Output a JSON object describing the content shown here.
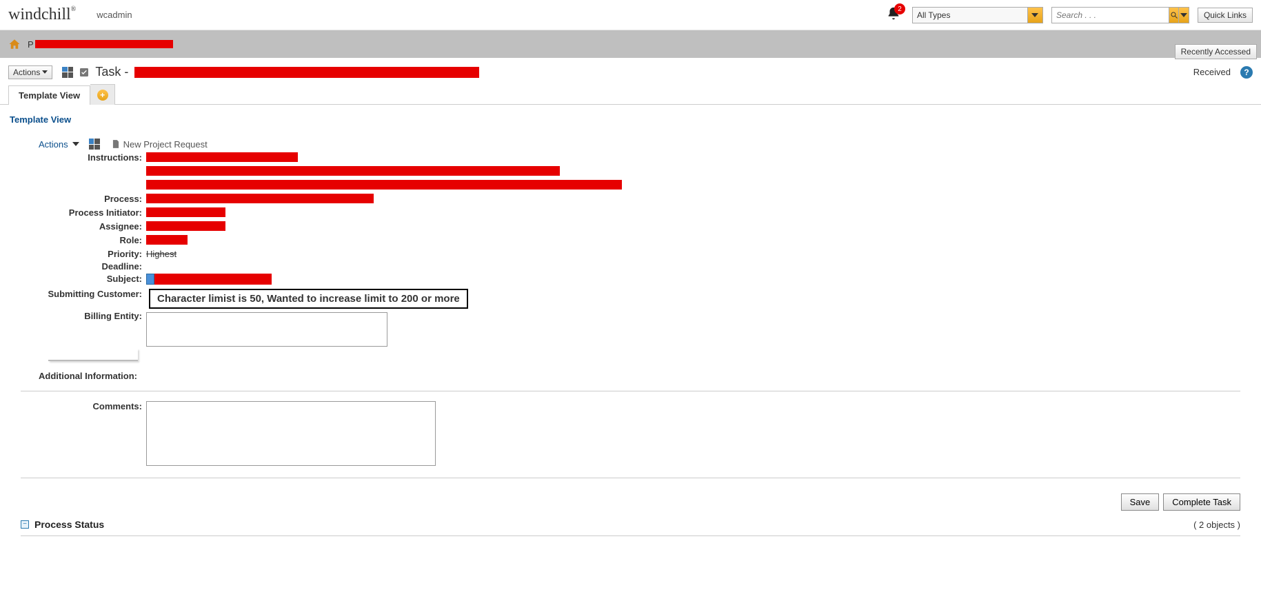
{
  "header": {
    "brand": "windchill",
    "brand_reg": "®",
    "user": "wcadmin",
    "notification_count": "2",
    "type_select": "All Types",
    "search_placeholder": "Search . . .",
    "quick_links_label": "Quick Links"
  },
  "subnav": {
    "recently_label": "Recently Accessed",
    "breadcrumb_prefix": "P"
  },
  "title_area": {
    "actions_label": "Actions",
    "task_title_prefix": "Task -",
    "right_label": "Received",
    "help_glyph": "?"
  },
  "tabs": {
    "template_view": "Template View"
  },
  "section_link": "Template View",
  "sub_actions": {
    "label": "Actions",
    "new_project_request": "New Project Request"
  },
  "form": {
    "labels": {
      "instructions": "Instructions:",
      "process": "Process:",
      "process_initiator": "Process Initiator:",
      "assignee": "Assignee:",
      "role": "Role:",
      "priority": "Priority:",
      "deadline": "Deadline:",
      "subject": "Subject:",
      "submitting_customer": "Submitting Customer:",
      "billing_entity": "Billing Entity:",
      "additional_info": "Additional Information:",
      "comments": "Comments:"
    },
    "priority_value": "Highest",
    "annotation_text": "Character limist is 50, Wanted to increase limit to 200 or more"
  },
  "footer": {
    "save_label": "Save",
    "complete_task_label": "Complete Task"
  },
  "process_status": {
    "title": "Process Status",
    "count_text": "( 2 objects )"
  }
}
